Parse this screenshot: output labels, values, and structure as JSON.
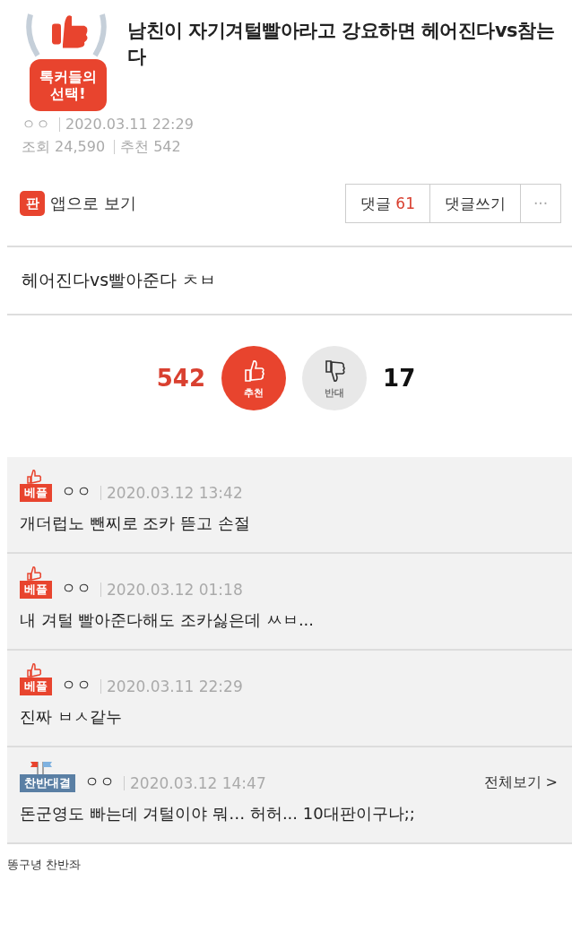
{
  "post": {
    "badge": [
      "톡커들의",
      "선택!"
    ],
    "title": "남친이 자기겨털빨아라고 강요하면 헤어진다vs참는다",
    "author": "ㅇㅇ",
    "date": "2020.03.11 22:29",
    "views_label": "조회",
    "views": "24,590",
    "likes_label": "추천",
    "likes": "542"
  },
  "toolbar": {
    "app_icon": "판",
    "app_link": "앱으로 보기",
    "comments_label": "댓글",
    "comments_count": "61",
    "write_button": "댓글쓰기",
    "more_button": "···"
  },
  "body": "헤어진다vs빨아준다 ㅊㅂ",
  "votes": {
    "up_count": "542",
    "up_label": "추천",
    "down_label": "반대",
    "down_count": "17"
  },
  "comments": [
    {
      "kind": "best",
      "badge": "베플",
      "author": "ㅇㅇ",
      "date": "2020.03.12 13:42",
      "text": "개더럽노 뺀찌로 조카 뜯고 손절"
    },
    {
      "kind": "best",
      "badge": "베플",
      "author": "ㅇㅇ",
      "date": "2020.03.12 01:18",
      "text": "내 겨털 빨아준다해도 조카싫은데 ㅆㅂ..."
    },
    {
      "kind": "best",
      "badge": "베플",
      "author": "ㅇㅇ",
      "date": "2020.03.11 22:29",
      "text": "진짜 ㅂㅅ같누"
    },
    {
      "kind": "debate",
      "badge": "찬반대결",
      "author": "ㅇㅇ",
      "date": "2020.03.12 14:47",
      "more": "전체보기 >",
      "text": "돈군영도 빠는데 겨털이야 뭐… 허허... 10대판이구나;;"
    }
  ],
  "footer": "똥구녕 찬반좌"
}
